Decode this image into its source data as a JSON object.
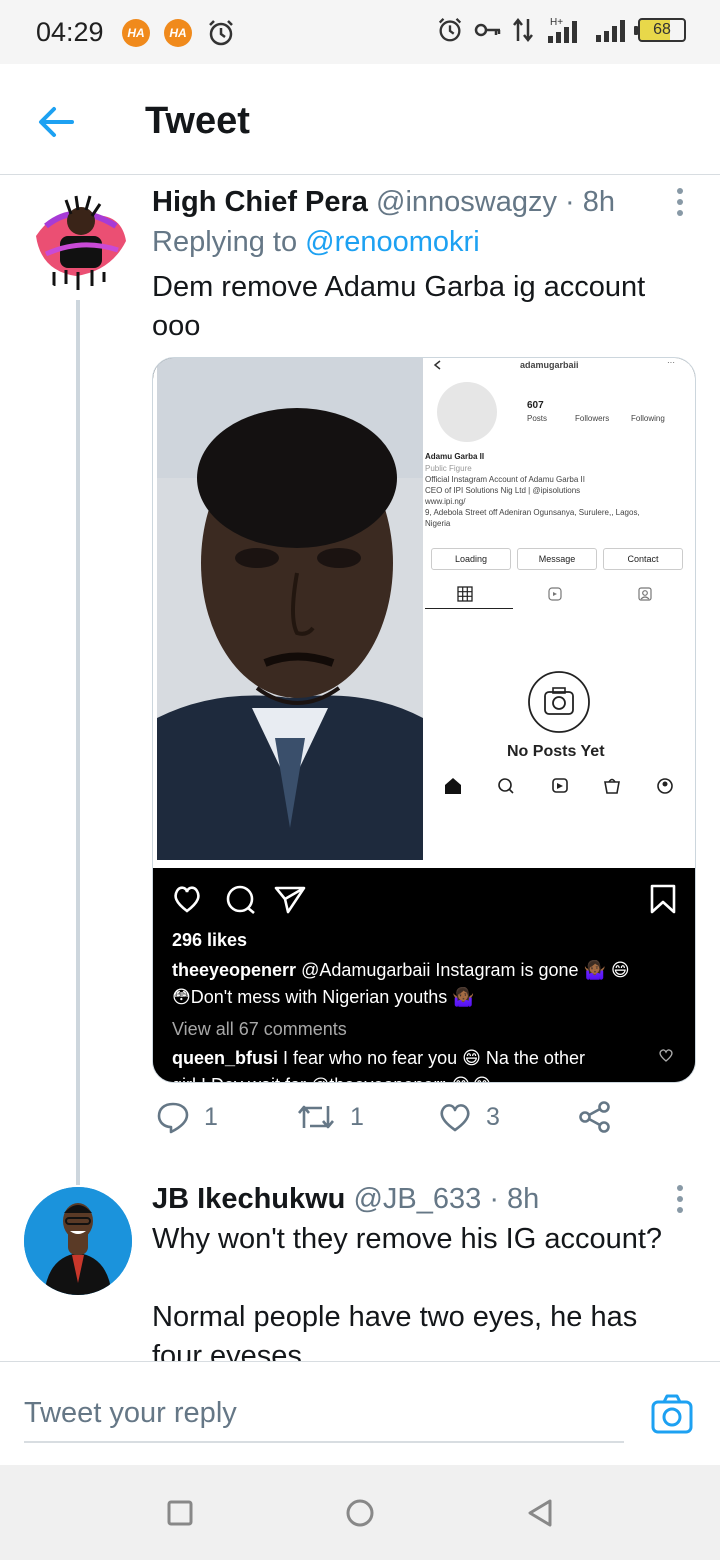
{
  "status_bar": {
    "time": "04:29",
    "left_badges": [
      "HA",
      "HA"
    ],
    "battery": "68",
    "network": "H+",
    "icons": [
      "alarm-icon",
      "key-icon",
      "data-arrows-icon",
      "signal-icon",
      "signal-icon",
      "battery-icon"
    ]
  },
  "header": {
    "title": "Tweet",
    "back_icon": "back-arrow-icon"
  },
  "tweet": {
    "name": "High Chief Pera",
    "handle": "@innoswagzy",
    "time": "· 8h",
    "replying_label": "Replying to",
    "replying_to": "@renoomokri",
    "text": "Dem remove Adamu Garba ig account ooo",
    "media": {
      "ig_username": "adamugarbaii",
      "posts_count": "607",
      "stat_labels": [
        "Posts",
        "Followers",
        "Following"
      ],
      "bio_name": "Adamu Garba II",
      "bio_category": "Public Figure",
      "bio_lines": [
        "Official Instagram Account of Adamu Garba II",
        "CEO of IPI Solutions Nig Ltd | @ipisolutions",
        "www.ipi.ng/",
        "9, Adebola Street off Adeniran Ogunsanya, Surulere,, Lagos,",
        "Nigeria"
      ],
      "buttons": [
        "Loading",
        "Message",
        "Contact"
      ],
      "empty_label": "No Posts Yet",
      "likes": "296 likes",
      "caption_user": "theeyeopenerr",
      "caption_line1": "@Adamugarbaii Instagram is gone 🤷🏾‍♀️ 😄",
      "caption_line2": "😳Don't mess with Nigerian youths 🤷🏾‍♀️",
      "view_comments": "View all 67 comments",
      "comment_user": "queen_bfusi",
      "comment_text": "I fear who no fear you 😄 Na the other",
      "comment_overflow": "girl I Dey wait for @theeyeopenerr 😂😂"
    },
    "actions": {
      "replies": "1",
      "retweets": "1",
      "likes": "3"
    }
  },
  "reply_tweet": {
    "name": "JB Ikechukwu",
    "handle": "@JB_633",
    "time": "· 8h",
    "text_line1": "Why won't they remove his IG account?",
    "text_line2": "Normal people have two eyes, he has",
    "text_line3": "four eyeses"
  },
  "reply_box": {
    "placeholder": "Tweet your reply"
  },
  "colors": {
    "accent": "#1da1f2",
    "muted": "#657786",
    "text": "#14171a",
    "divider": "#d8dde1"
  }
}
